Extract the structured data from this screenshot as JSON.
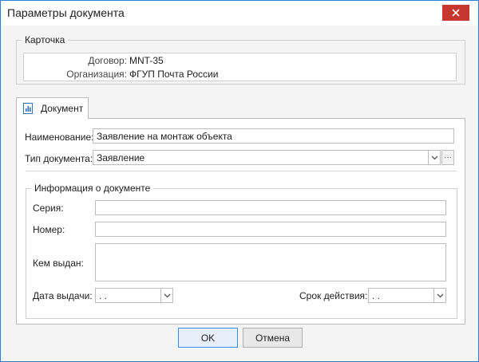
{
  "window": {
    "title": "Параметры документа",
    "close_glyph": "✕"
  },
  "card": {
    "title": "Карточка",
    "contract_label": "Договор:",
    "contract_value": "MNT-35",
    "org_label": "Организация:",
    "org_value": "ФГУП Почта России"
  },
  "tab": {
    "label": "Документ",
    "icon": "document-chart-icon"
  },
  "form": {
    "name_label": "Наименование:",
    "name_value": "Заявление на монтаж объекта",
    "doctype_label": "Тип документа:",
    "doctype_value": "Заявление",
    "ellipsis": "···"
  },
  "info": {
    "title": "Информация о документе",
    "series_label": "Серия:",
    "series_value": "",
    "number_label": "Номер:",
    "number_value": "",
    "issued_by_label": "Кем выдан:",
    "issued_by_value": "",
    "issue_date_label": "Дата выдачи:",
    "issue_date_value": " .  .",
    "validity_label": "Срок действия:",
    "validity_value": " .  ."
  },
  "buttons": {
    "ok": "OK",
    "cancel": "Отмена"
  },
  "colors": {
    "accent": "#2b7fd8",
    "close": "#c8372f"
  }
}
